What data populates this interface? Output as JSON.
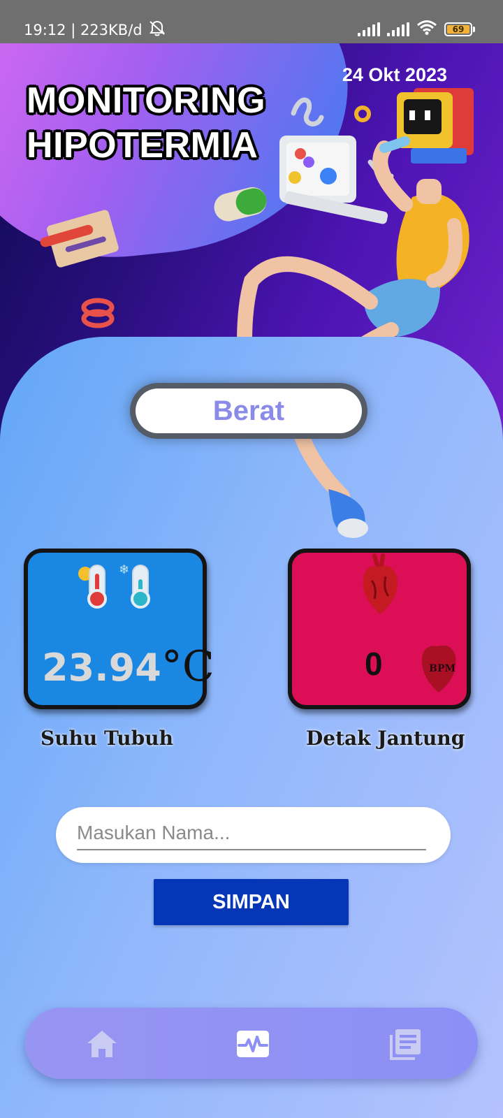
{
  "status_bar": {
    "time_speed": "19:12 | 223KB/d",
    "battery": "69",
    "icons": [
      "bell-off-icon",
      "signal-icon",
      "signal-icon",
      "wifi-icon",
      "battery-icon"
    ]
  },
  "header": {
    "title_line1": "MONITORING",
    "title_line2": "HIPOTERMIA",
    "date": "24 Okt 2023"
  },
  "weight": {
    "label": "Berat"
  },
  "temperature_card": {
    "value": "23.94",
    "unit": "°C",
    "caption": "Suhu Tubuh",
    "icons": [
      "thermometer-hot-icon",
      "thermometer-cold-icon"
    ],
    "color": "#1a87e3"
  },
  "heart_card": {
    "value": "0",
    "unit": "BPM",
    "caption": "Detak Jantung",
    "icons": [
      "heart-icon",
      "heart-bpm-icon"
    ],
    "color": "#dc0e55"
  },
  "form": {
    "name_placeholder": "Masukan Nama...",
    "name_value": "",
    "save_label": "SIMPAN"
  },
  "bottom_nav": {
    "items": [
      {
        "icon": "home-icon"
      },
      {
        "icon": "activity-icon",
        "active": true
      },
      {
        "icon": "list-icon"
      }
    ]
  }
}
